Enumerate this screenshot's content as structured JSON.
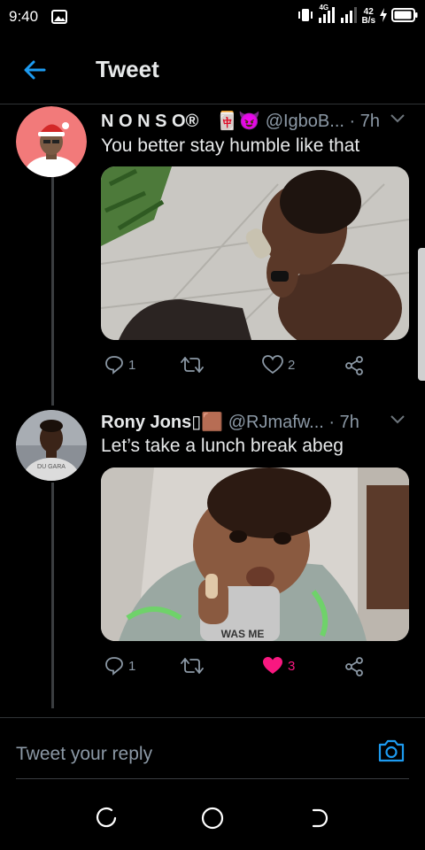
{
  "status_bar": {
    "time": "9:40",
    "network_type": "4G",
    "speed_value": "42",
    "speed_unit": "B/s",
    "battery_level": 0.95
  },
  "header": {
    "title": "Tweet",
    "back_icon": "arrow-left-icon"
  },
  "tweets": [
    {
      "name": "N O N S O® ",
      "name_emojis": "🀄😈",
      "handle": "@IgboB...",
      "time": "· 7h",
      "text": "You better stay humble like that",
      "replies": "1",
      "retweets": "",
      "likes": "2",
      "liked": false
    },
    {
      "name": "Rony Jons",
      "name_emojis": "▯🟫",
      "handle": "@RJmafw...",
      "time": "· 7h",
      "text": "Let’s take a lunch break abeg",
      "replies": "1",
      "retweets": "",
      "likes": "3",
      "liked": true
    }
  ],
  "reply_bar": {
    "placeholder": "Tweet your reply",
    "camera_icon": "camera-icon"
  },
  "colors": {
    "accent": "#1d9bf0",
    "like": "#f91880",
    "muted": "#8b98a5",
    "background": "#000000"
  },
  "nav_bar": {
    "icons": [
      "recent-apps-icon",
      "home-circle-icon",
      "back-nav-icon"
    ]
  }
}
